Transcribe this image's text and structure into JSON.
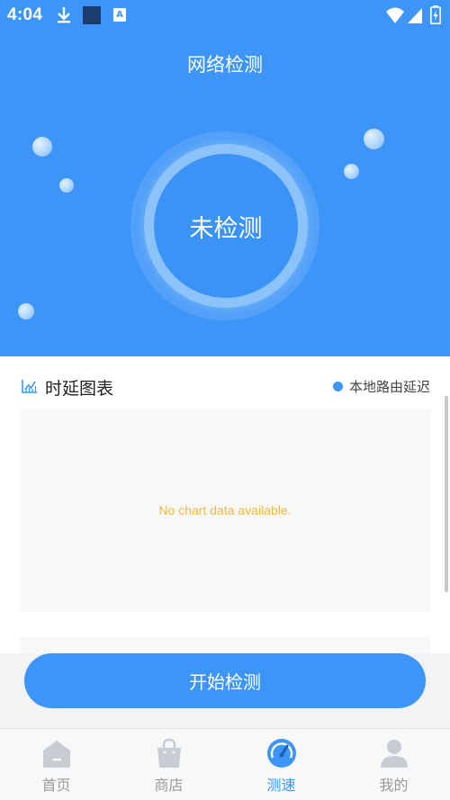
{
  "status_bar": {
    "time": "4:04",
    "badge_letter": "A"
  },
  "header": {
    "title": "网络检测"
  },
  "gauge": {
    "status_text": "未检测"
  },
  "chart_card": {
    "title": "时延图表",
    "legend_label": "本地路由延迟",
    "empty_message": "No chart data available."
  },
  "action": {
    "start_label": "开始检测"
  },
  "nav": {
    "items": [
      {
        "label": "首页",
        "icon": "home-icon",
        "active": false
      },
      {
        "label": "商店",
        "icon": "shopping-bag-icon",
        "active": false
      },
      {
        "label": "测速",
        "icon": "speedometer-icon",
        "active": true
      },
      {
        "label": "我的",
        "icon": "user-icon",
        "active": false
      }
    ]
  },
  "colors": {
    "accent": "#3d95f8",
    "inactive": "#999999",
    "empty_text": "#f0b83b"
  }
}
